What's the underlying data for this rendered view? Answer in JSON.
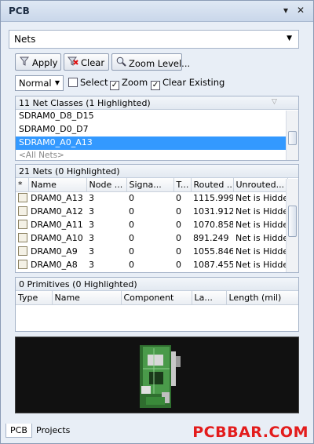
{
  "panel": {
    "title": "PCB"
  },
  "mode_select": {
    "value": "Nets"
  },
  "toolbar": {
    "apply_label": "Apply",
    "clear_label": "Clear",
    "zoom_level_label": "Zoom Level..."
  },
  "options": {
    "mask_mode": "Normal",
    "select_label": "Select",
    "select_checked": false,
    "zoom_label": "Zoom",
    "zoom_checked": true,
    "clear_existing_label": "Clear Existing",
    "clear_existing_checked": true
  },
  "net_classes": {
    "header": "11 Net Classes (1 Highlighted)",
    "items": [
      {
        "label": "SDRAM0_D8_D15"
      },
      {
        "label": "SDRAM0_D0_D7"
      },
      {
        "label": "SDRAM0_A0_A13"
      },
      {
        "label": "<All Nets>"
      }
    ]
  },
  "nets": {
    "header": "21 Nets (0 Highlighted)",
    "columns": [
      "*",
      "Name",
      "Node ...",
      "Signa...",
      "T...",
      "Routed ...",
      "Unrouted..."
    ],
    "rows": [
      {
        "name": "DRAM0_A13",
        "nodes": "3",
        "signal": "0",
        "t": "0",
        "routed": "1115.999",
        "unrouted": "Net is Hidde"
      },
      {
        "name": "DRAM0_A12",
        "nodes": "3",
        "signal": "0",
        "t": "0",
        "routed": "1031.912",
        "unrouted": "Net is Hidde"
      },
      {
        "name": "DRAM0_A11",
        "nodes": "3",
        "signal": "0",
        "t": "0",
        "routed": "1070.858",
        "unrouted": "Net is Hidde"
      },
      {
        "name": "DRAM0_A10",
        "nodes": "3",
        "signal": "0",
        "t": "0",
        "routed": "891.249",
        "unrouted": "Net is Hidde"
      },
      {
        "name": "DRAM0_A9",
        "nodes": "3",
        "signal": "0",
        "t": "0",
        "routed": "1055.846",
        "unrouted": "Net is Hidde"
      },
      {
        "name": "DRAM0_A8",
        "nodes": "3",
        "signal": "0",
        "t": "0",
        "routed": "1087.455",
        "unrouted": "Net is Hidde"
      }
    ]
  },
  "primitives": {
    "header": "0 Primitives (0 Highlighted)",
    "columns": [
      "Type",
      "Name",
      "Component",
      "La...",
      "Length (mil)"
    ]
  },
  "bottom_tabs": {
    "pcb": "PCB",
    "projects": "Projects"
  },
  "watermark": "PCBBAR.COM",
  "colors": {
    "selection": "#3399ff",
    "preview_bg": "#111111",
    "board_green": "#3a8a3a",
    "watermark": "#e31c1c"
  },
  "icons": [
    "pin-icon",
    "close-icon",
    "funnel-icon",
    "eraser-icon",
    "magnifier-icon",
    "chevron-down-icon",
    "sort-icon"
  ]
}
